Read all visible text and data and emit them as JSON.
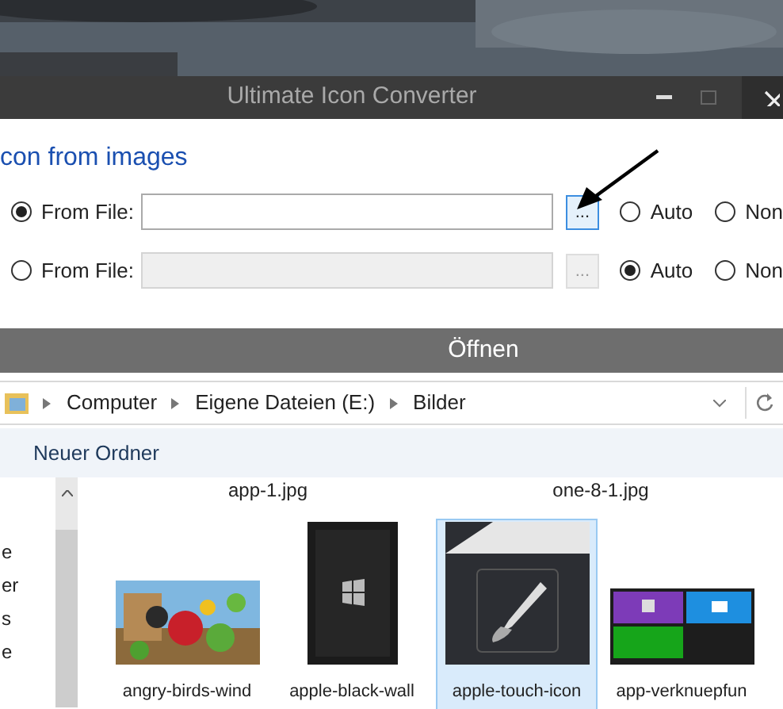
{
  "app_window": {
    "title": "Ultimate Icon Converter",
    "heading": "con from images",
    "rows": [
      {
        "source": {
          "label": "From File:",
          "selected": true
        },
        "field_disabled": false,
        "browse": {
          "label": "...",
          "focused": true
        },
        "options": [
          {
            "label": "Auto",
            "selected": false
          },
          {
            "label": "Non",
            "selected": false
          }
        ]
      },
      {
        "source": {
          "label": "From File:",
          "selected": false
        },
        "field_disabled": true,
        "browse": {
          "label": "...",
          "focused": false
        },
        "options": [
          {
            "label": "Auto",
            "selected": true
          },
          {
            "label": "Non",
            "selected": false
          }
        ]
      }
    ]
  },
  "open_dialog": {
    "title": "Öffnen",
    "breadcrumb": [
      "Computer",
      "Eigene Dateien (E:)",
      "Bilder"
    ],
    "toolbar": [
      "Neuer Ordner"
    ],
    "nav_items": [
      "e",
      "er",
      "s",
      "e"
    ],
    "top_captions": [
      {
        "text": "app-1.jpg"
      },
      {
        "text": "one-8-1.jpg"
      }
    ],
    "files": [
      {
        "name": "angry-birds-wind",
        "selected": false,
        "kind": "birds"
      },
      {
        "name": "apple-black-wall",
        "selected": false,
        "kind": "dark"
      },
      {
        "name": "apple-touch-icon",
        "selected": true,
        "kind": "brush"
      },
      {
        "name": "app-verknuepfun",
        "selected": false,
        "kind": "tiles"
      }
    ]
  }
}
